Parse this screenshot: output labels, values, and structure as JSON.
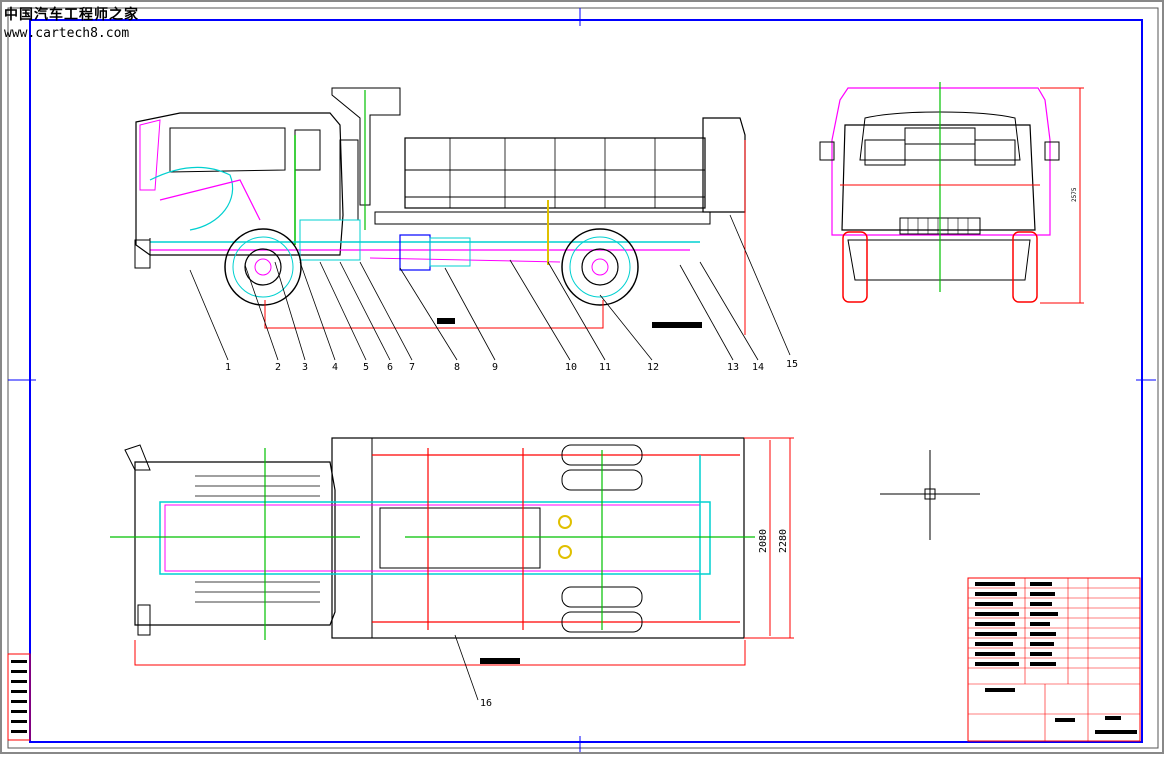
{
  "watermark": {
    "title": "中国汽车工程师之家",
    "url": "www.cartech8.com"
  },
  "part_labels": [
    "1",
    "2",
    "3",
    "4",
    "5",
    "6",
    "7",
    "8",
    "9",
    "10",
    "11",
    "12",
    "13",
    "14",
    "15",
    "16"
  ],
  "dimensions": {
    "inner_width": "2080",
    "outer_width": "2280",
    "front_height": "2575"
  },
  "colors": {
    "frame_blue": "#0000ff",
    "dim_red": "#ff0000",
    "cyan": "#00d0d0",
    "magenta": "#ff00ff",
    "green": "#00c000",
    "yellow": "#e0c000",
    "outline": "#000000"
  }
}
